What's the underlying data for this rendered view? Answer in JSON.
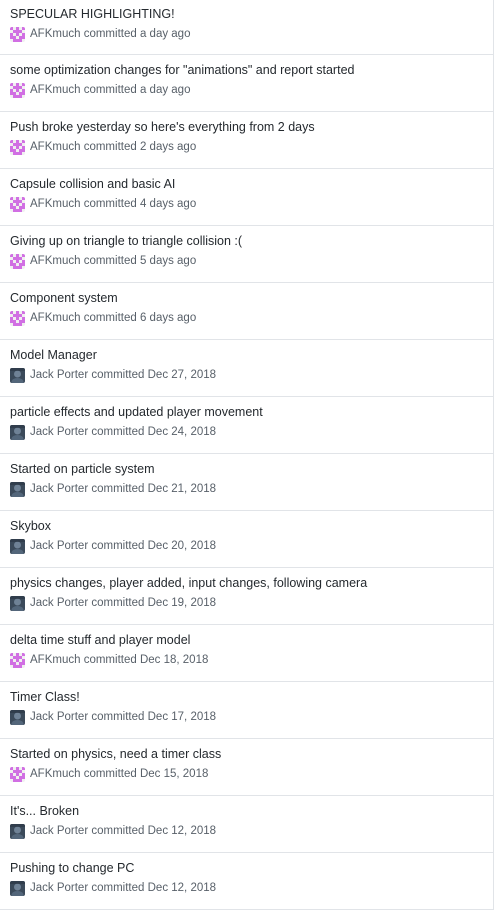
{
  "colors": {
    "title_text": "#24292e",
    "meta_text": "#586069",
    "divider": "#e1e4e8",
    "identicon_pink": "#d16fe3",
    "photo_avatar_dark": "#3b4a5a"
  },
  "committed_word": "committed",
  "commits": [
    {
      "title": "SPECULAR HIGHLIGHTING!",
      "author": "AFKmuch",
      "avatar": "identicon-avatar",
      "when": "a day ago"
    },
    {
      "title": "some optimization changes for \"animations\" and report started",
      "author": "AFKmuch",
      "avatar": "identicon-avatar",
      "when": "a day ago"
    },
    {
      "title": "Push broke yesterday so here's everything from 2 days",
      "author": "AFKmuch",
      "avatar": "identicon-avatar",
      "when": "2 days ago"
    },
    {
      "title": "Capsule collision and basic AI",
      "author": "AFKmuch",
      "avatar": "identicon-avatar",
      "when": "4 days ago"
    },
    {
      "title": "Giving up on triangle to triangle collision :(",
      "author": "AFKmuch",
      "avatar": "identicon-avatar",
      "when": "5 days ago"
    },
    {
      "title": "Component system",
      "author": "AFKmuch",
      "avatar": "identicon-avatar",
      "when": "6 days ago"
    },
    {
      "title": "Model Manager",
      "author": "Jack Porter",
      "avatar": "photo-avatar",
      "when": "Dec 27, 2018"
    },
    {
      "title": "particle effects and updated player movement",
      "author": "Jack Porter",
      "avatar": "photo-avatar",
      "when": "Dec 24, 2018"
    },
    {
      "title": "Started on particle system",
      "author": "Jack Porter",
      "avatar": "photo-avatar",
      "when": "Dec 21, 2018"
    },
    {
      "title": "Skybox",
      "author": "Jack Porter",
      "avatar": "photo-avatar",
      "when": "Dec 20, 2018"
    },
    {
      "title": "physics changes, player added, input changes, following camera",
      "author": "Jack Porter",
      "avatar": "photo-avatar",
      "when": "Dec 19, 2018"
    },
    {
      "title": "delta time stuff and player model",
      "author": "AFKmuch",
      "avatar": "identicon-avatar",
      "when": "Dec 18, 2018"
    },
    {
      "title": "Timer Class!",
      "author": "Jack Porter",
      "avatar": "photo-avatar",
      "when": "Dec 17, 2018"
    },
    {
      "title": "Started on physics, need a timer class",
      "author": "AFKmuch",
      "avatar": "identicon-avatar",
      "when": "Dec 15, 2018"
    },
    {
      "title": "It's... Broken",
      "author": "Jack Porter",
      "avatar": "photo-avatar",
      "when": "Dec 12, 2018"
    },
    {
      "title": "Pushing to change PC",
      "author": "Jack Porter",
      "avatar": "photo-avatar",
      "when": "Dec 12, 2018"
    }
  ]
}
